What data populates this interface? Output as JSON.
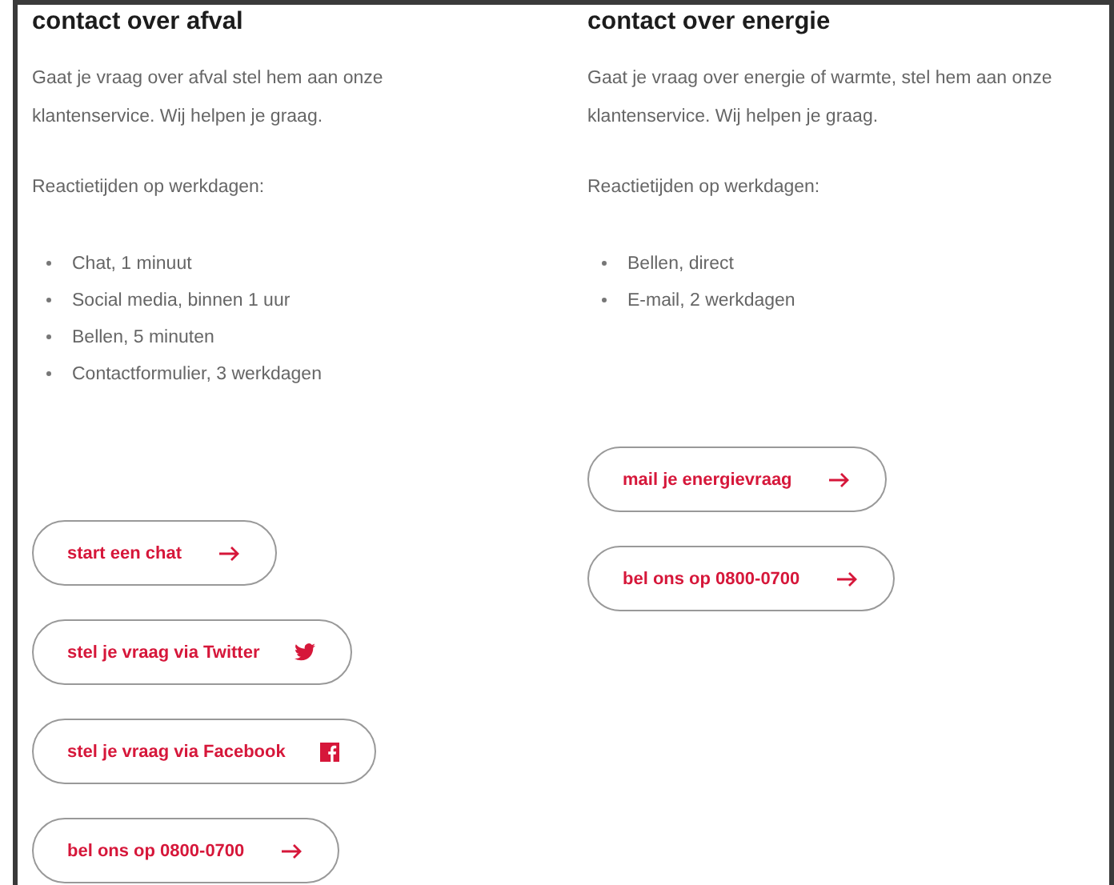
{
  "columns": [
    {
      "title": "contact over afval",
      "intro": "Gaat je vraag over afval stel hem aan onze klantenservice. Wij helpen je graag.",
      "response_label": "Reactietijden op werkdagen:",
      "response_times": [
        "Chat, 1 minuut",
        "Social media, binnen 1 uur",
        "Bellen, 5 minuten",
        "Contactformulier, 3 werkdagen"
      ],
      "buttons": [
        {
          "label": "start een chat",
          "kind": "arrow"
        },
        {
          "label": "stel je vraag via Twitter",
          "kind": "twitter"
        },
        {
          "label": "stel je vraag via Facebook",
          "kind": "facebook"
        },
        {
          "label": "bel ons op 0800-0700",
          "kind": "arrow"
        }
      ]
    },
    {
      "title": "contact over energie",
      "intro": "Gaat je vraag over energie of warmte, stel hem aan onze klantenservice. Wij helpen je graag.",
      "response_label": "Reactietijden op werkdagen:",
      "response_times": [
        "Bellen, direct",
        "E-mail, 2 werkdagen"
      ],
      "buttons": [
        {
          "label": "mail je energievraag",
          "kind": "arrow"
        },
        {
          "label": "bel ons op 0800-0700",
          "kind": "arrow"
        }
      ]
    }
  ]
}
